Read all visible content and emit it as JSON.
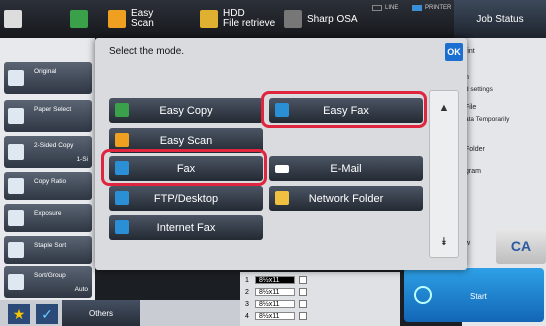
{
  "topbar": {
    "items": [
      {
        "label": "",
        "icon": "copy-icon"
      },
      {
        "label": "Easy\nScan",
        "icon": "scan-icon"
      },
      {
        "label": "HDD\nFile retrieve",
        "icon": "folder-icon"
      },
      {
        "label": "Sharp OSA",
        "icon": "osa-icon"
      }
    ],
    "line_label": "LINE",
    "printer_label": "PRINTER",
    "job_status": "Job Status"
  },
  "left": {
    "buttons": [
      {
        "label": "Original",
        "sub": ""
      },
      {
        "label": "Paper Select",
        "sub": ""
      },
      {
        "label": "2-Sided Copy",
        "sub": "1-Si"
      },
      {
        "label": "Copy Ratio",
        "sub": ""
      },
      {
        "label": "Exposure",
        "sub": ""
      },
      {
        "label": "Staple Sort",
        "sub": ""
      },
      {
        "label": "Sort/Group",
        "sub": "Auto"
      }
    ],
    "others": "Others"
  },
  "right": {
    "texts": [
      "rint",
      "n",
      "d settings",
      "File",
      "ata Temporarily",
      "Folder",
      "gram",
      "w"
    ],
    "ca": "CA",
    "start": "Start"
  },
  "dialog": {
    "title": "Select the mode.",
    "ok": "OK",
    "modes": [
      {
        "label": "Easy Copy",
        "icon_color": "#3aa04a"
      },
      {
        "label": "Easy Fax",
        "icon_color": "#2b8fd6"
      },
      {
        "label": "Easy Scan",
        "icon_color": "#f0a020"
      },
      {
        "label": "Fax",
        "icon_color": "#2b8fd6"
      },
      {
        "label": "E-Mail",
        "icon_color": "#ffffff"
      },
      {
        "label": "FTP/Desktop",
        "icon_color": "#2b8fd6"
      },
      {
        "label": "Network Folder",
        "icon_color": "#f0c040"
      },
      {
        "label": "Internet Fax",
        "icon_color": "#2b8fd6"
      }
    ]
  },
  "trays": [
    {
      "num": "1",
      "size": "8½x11"
    },
    {
      "num": "2",
      "size": "8½x11"
    },
    {
      "num": "3",
      "size": "8½x11"
    },
    {
      "num": "4",
      "size": "8½x11"
    }
  ]
}
